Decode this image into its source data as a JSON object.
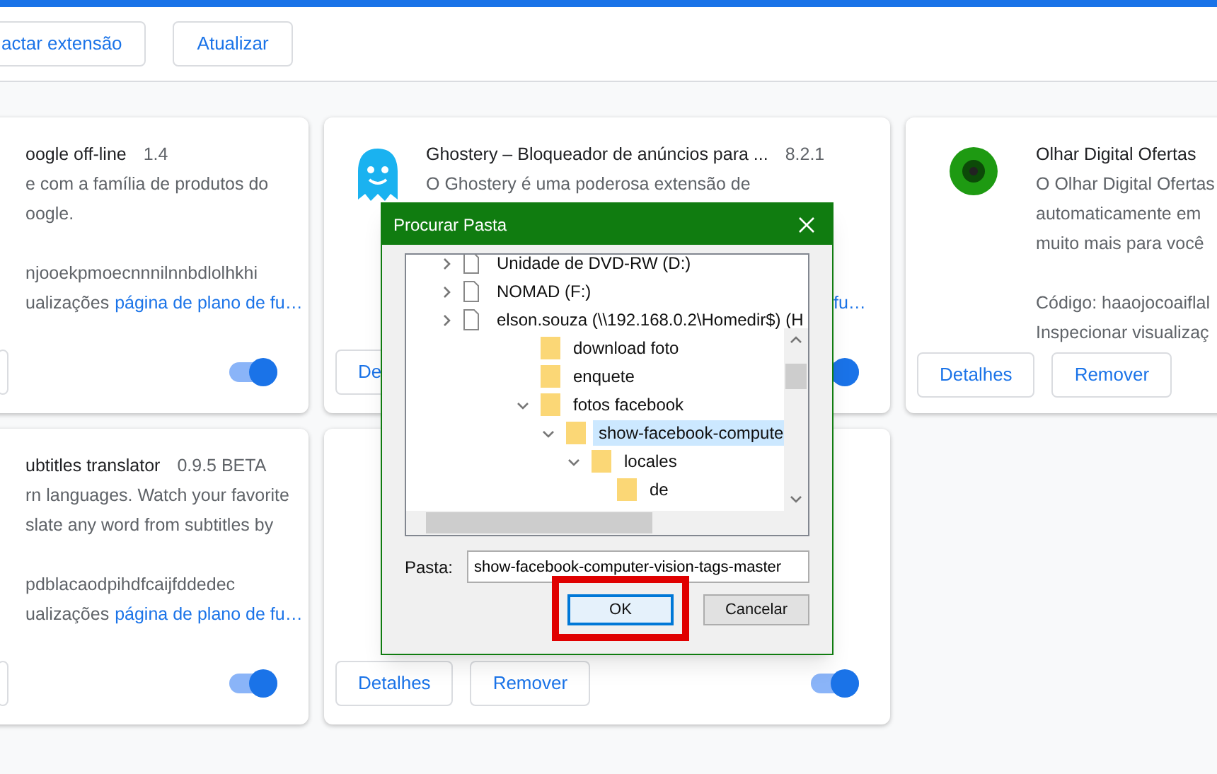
{
  "toolbar": {
    "buttons": [
      "actar extensão",
      "Atualizar"
    ]
  },
  "card_rows": [
    [
      {
        "title": "oogle off-line",
        "version": "1.4",
        "description": [
          "e com a família de produtos do",
          "oogle."
        ],
        "code": "njooekpmoecnnnilnnbdlolhkhi",
        "inspect": "ualizações",
        "link": "página de plano de fu…",
        "toggle": {
          "on": true
        }
      },
      {
        "title": "Ghostery – Bloqueador de anúncios para ...",
        "version": "8.2.1",
        "description": [
          "O Ghostery é uma poderosa extensão de"
        ],
        "link_tail": "fu…",
        "buttons": [
          "De"
        ],
        "toggle": {
          "on": true
        }
      },
      {
        "title": "Olhar Digital Ofertas",
        "description": [
          "O Olhar Digital Ofertas",
          "automaticamente em",
          "muito mais para você"
        ],
        "code": "Código: haaojocoaiflal",
        "inspect": "Inspecionar visualizaç",
        "buttons": [
          "Detalhes",
          "Remover"
        ]
      }
    ],
    [
      {
        "title": "ubtitles translator",
        "version": "0.9.5 BETA",
        "description": [
          "rn languages. Watch your favorite",
          "slate any word from subtitles by"
        ],
        "code": "pdblacaodpihdfcaijfddedec",
        "inspect": "ualizações",
        "link": "página de plano de fu…",
        "toggle": {
          "on": true
        }
      },
      {
        "buttons": [
          "Detalhes",
          "Remover"
        ],
        "toggle": {
          "on": true
        }
      }
    ]
  ],
  "dialog": {
    "title": "Procurar Pasta",
    "tree": [
      {
        "label": "Unidade de DVD-RW (D:)",
        "expanded": false
      },
      {
        "label": "NOMAD (F:)",
        "expanded": false
      },
      {
        "label": "elson.souza (\\\\192.168.0.2\\Homedir$) (H",
        "expanded": false,
        "children": [
          {
            "label": "download foto",
            "selected": false
          },
          {
            "label": "enquete",
            "selected": false
          },
          {
            "label": "fotos facebook",
            "expanded": true,
            "selected": false,
            "children": [
              {
                "label": "show-facebook-compute",
                "expanded": true,
                "selected": true,
                "children": [
                  {
                    "label": "locales",
                    "expanded": true,
                    "selected": false,
                    "children": [
                      {
                        "label": "de",
                        "selected": false
                      }
                    ]
                  }
                ]
              }
            ]
          }
        ]
      }
    ],
    "folder_label": "Pasta:",
    "folder_value": "show-facebook-computer-vision-tags-master",
    "buttons": [
      {
        "label": "OK",
        "focused": true,
        "highlighted": true
      },
      {
        "label": "Cancelar",
        "focused": false
      }
    ]
  }
}
